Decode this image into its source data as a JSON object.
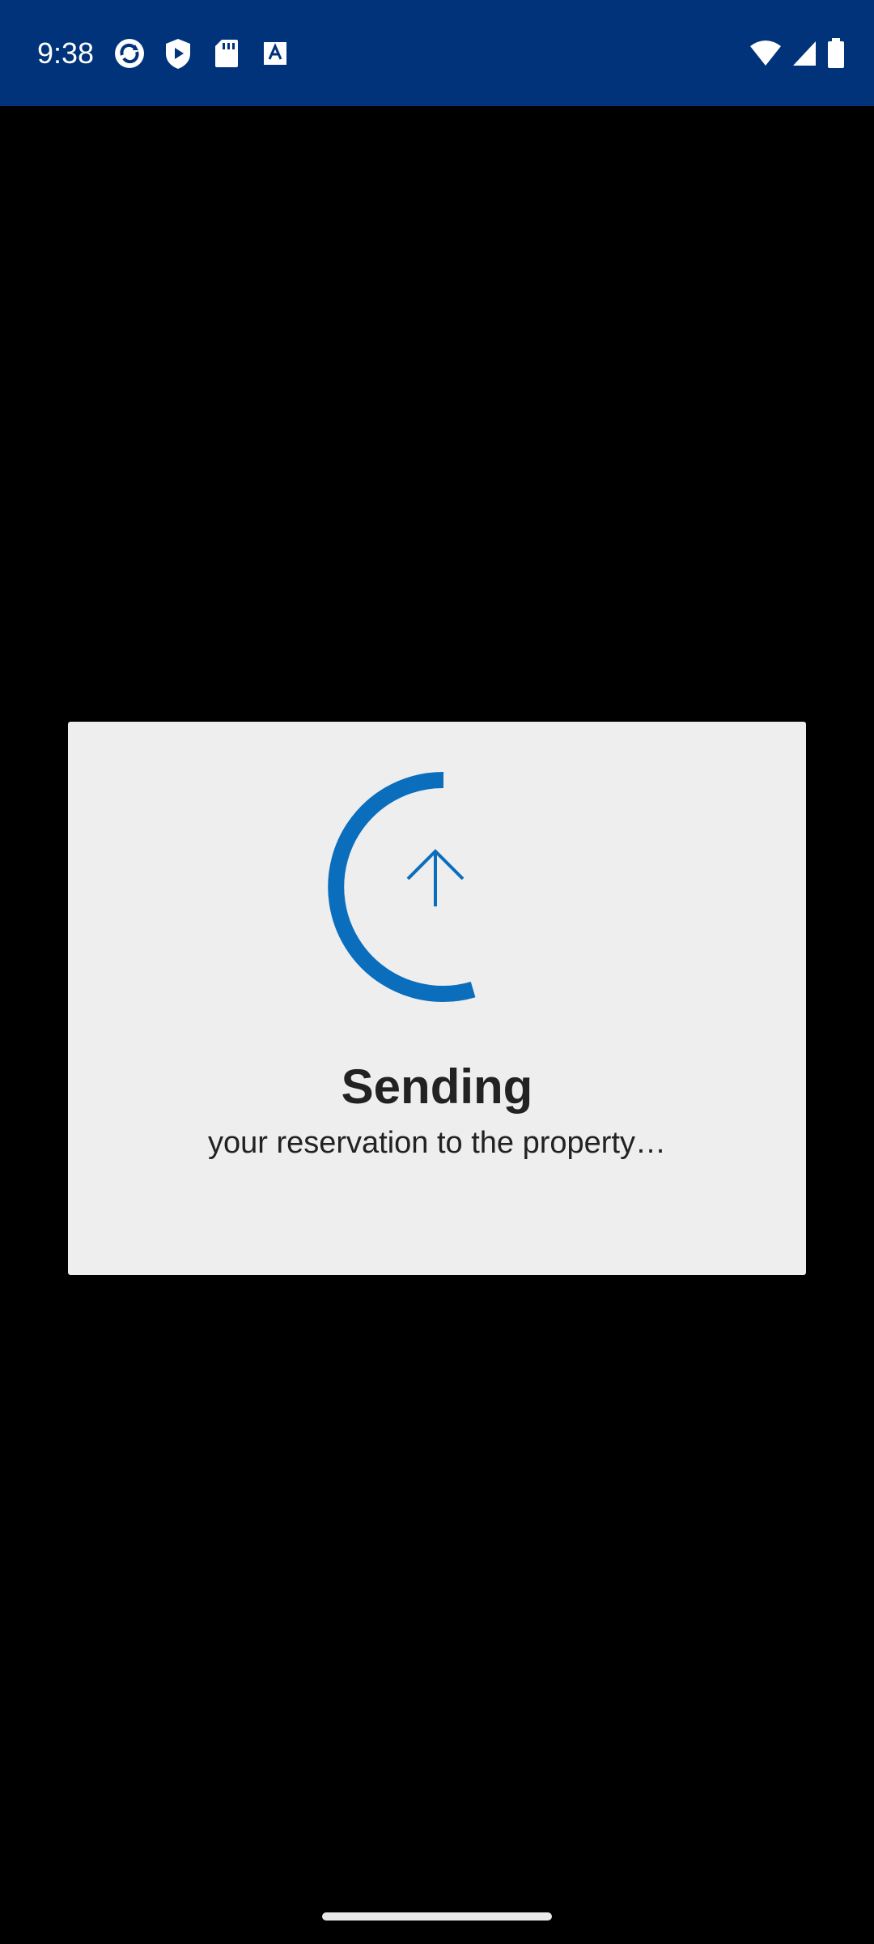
{
  "status_bar": {
    "time": "9:38",
    "background": "#00337a",
    "left_icons": [
      "sync-app-icon",
      "shield-play-icon",
      "sd-card-icon",
      "font-a-icon"
    ],
    "right_icons": [
      "wifi-icon",
      "cellular-signal-icon",
      "battery-icon"
    ]
  },
  "dialog": {
    "title": "Sending",
    "subtitle": "your reservation to the property…",
    "accent_color": "#0a6ebd",
    "icon": "upload-arrow-icon"
  }
}
